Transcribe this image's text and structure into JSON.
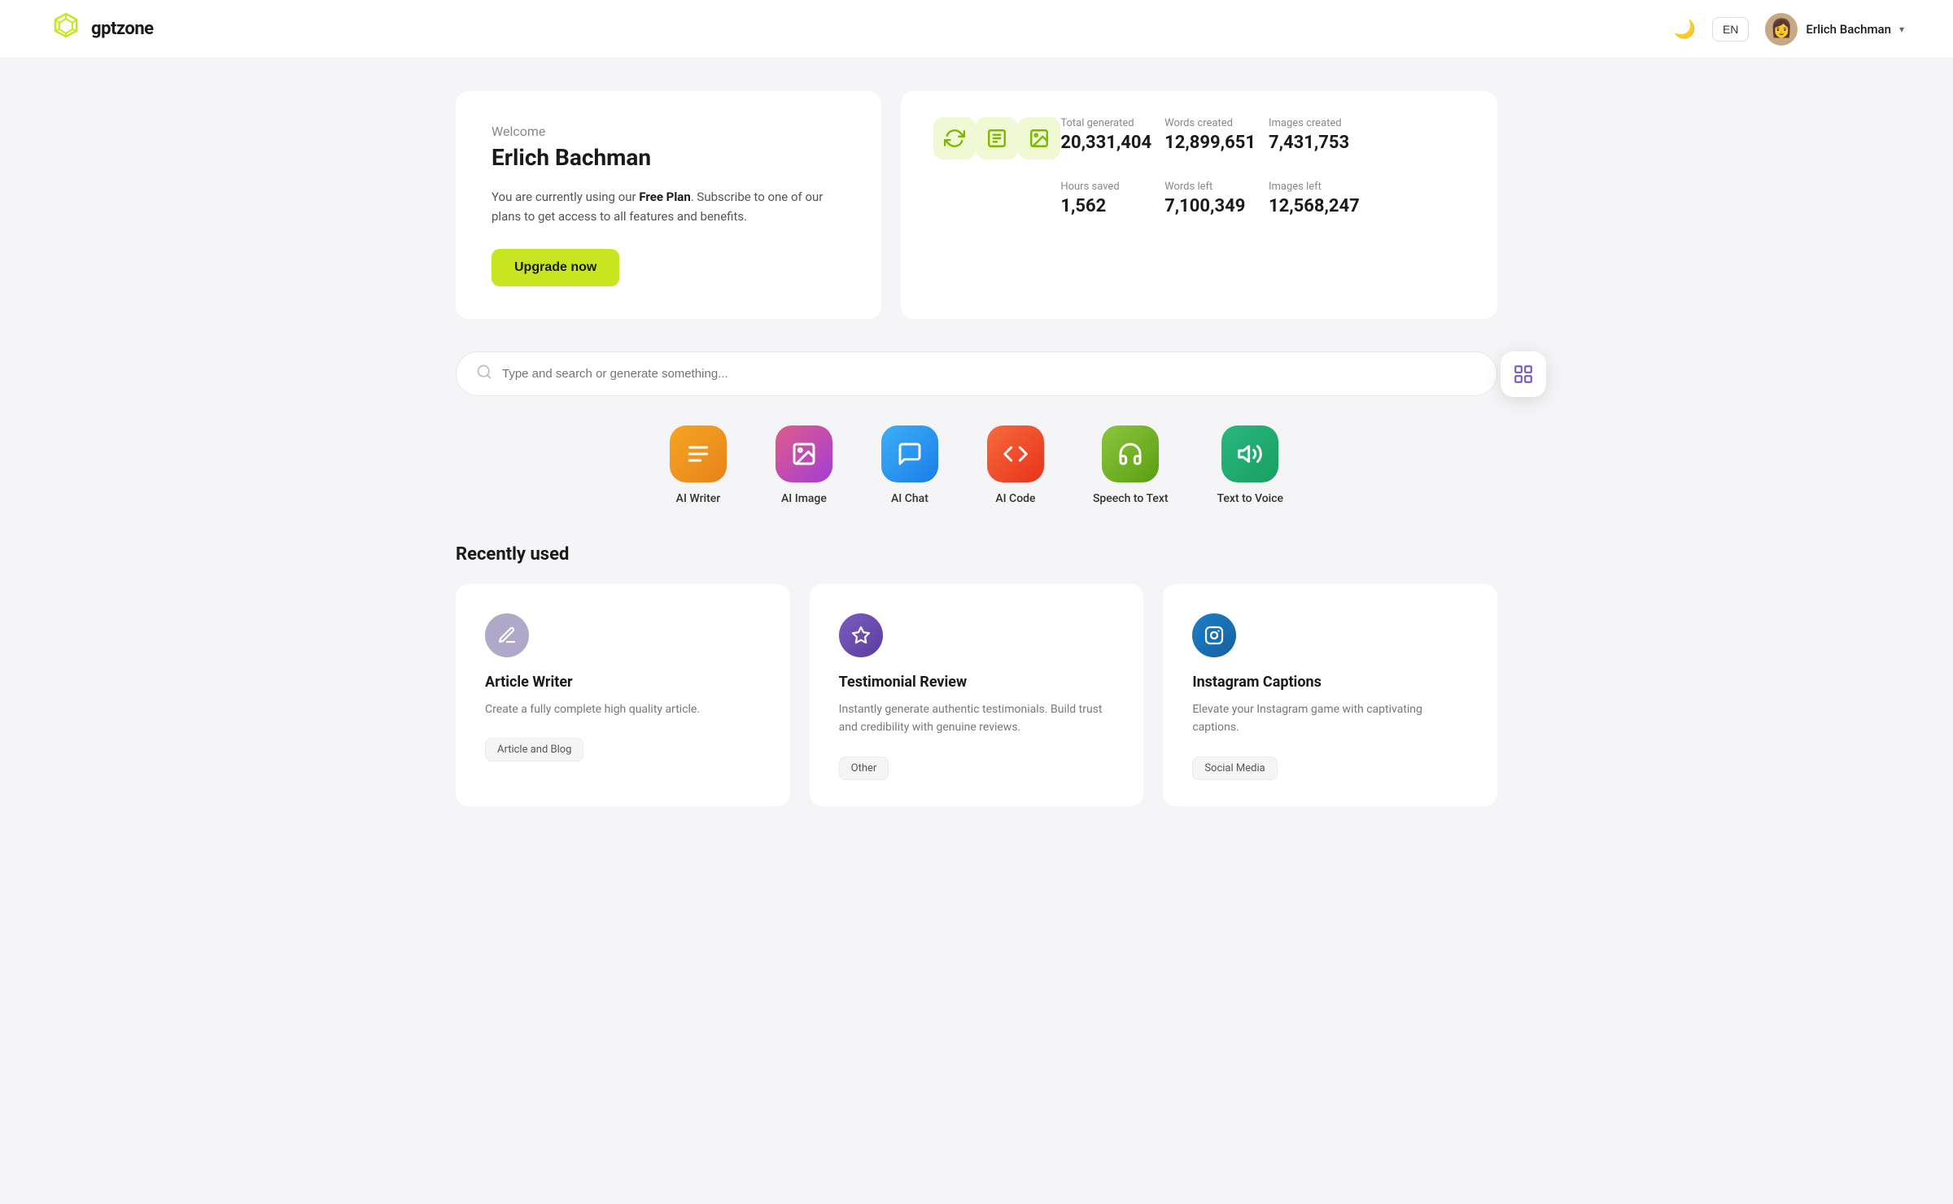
{
  "header": {
    "logo_text": "gptzone",
    "lang": "EN",
    "user_name": "Erlich Bachman"
  },
  "welcome": {
    "label": "Welcome",
    "name": "Erlich Bachman",
    "desc_plain": "You are currently using our ",
    "desc_bold": "Free Plan",
    "desc_end": ". Subscribe to one of our plans to get access to all features and benefits.",
    "upgrade_btn": "Upgrade now"
  },
  "stats": {
    "total_generated_label": "Total generated",
    "total_generated_value": "20,331,404",
    "words_created_label": "Words created",
    "words_created_value": "12,899,651",
    "images_created_label": "Images created",
    "images_created_value": "7,431,753",
    "hours_saved_label": "Hours saved",
    "hours_saved_value": "1,562",
    "words_left_label": "Words left",
    "words_left_value": "7,100,349",
    "images_left_label": "Images left",
    "images_left_value": "12,568,247"
  },
  "search": {
    "placeholder": "Type and search or generate something..."
  },
  "tools": [
    {
      "id": "ai-writer",
      "label": "AI Writer",
      "icon": "≡",
      "class": "icon-writer"
    },
    {
      "id": "ai-image",
      "label": "AI Image",
      "icon": "🖼",
      "class": "icon-image"
    },
    {
      "id": "ai-chat",
      "label": "AI Chat",
      "icon": "💬",
      "class": "icon-chat"
    },
    {
      "id": "ai-code",
      "label": "AI Code",
      "icon": "</>",
      "class": "icon-code"
    },
    {
      "id": "speech-to-text",
      "label": "Speech to Text",
      "icon": "🎧",
      "class": "icon-speech"
    },
    {
      "id": "text-to-voice",
      "label": "Text to Voice",
      "icon": "🔊",
      "class": "icon-voice"
    }
  ],
  "recently_used": {
    "section_title": "Recently used",
    "cards": [
      {
        "id": "article-writer",
        "icon": "✏️",
        "icon_class": "card-icon-writer",
        "title": "Article Writer",
        "desc": "Create a fully complete high quality article.",
        "tag": "Article and Blog"
      },
      {
        "id": "testimonial-review",
        "icon": "✦",
        "icon_class": "card-icon-testimonial",
        "title": "Testimonial Review",
        "desc": "Instantly generate authentic testimonials. Build trust and credibility with genuine reviews.",
        "tag": "Other"
      },
      {
        "id": "instagram-captions",
        "icon": "📷",
        "icon_class": "card-icon-instagram",
        "title": "Instagram Captions",
        "desc": "Elevate your Instagram game with captivating captions.",
        "tag": "Social Media"
      }
    ]
  }
}
